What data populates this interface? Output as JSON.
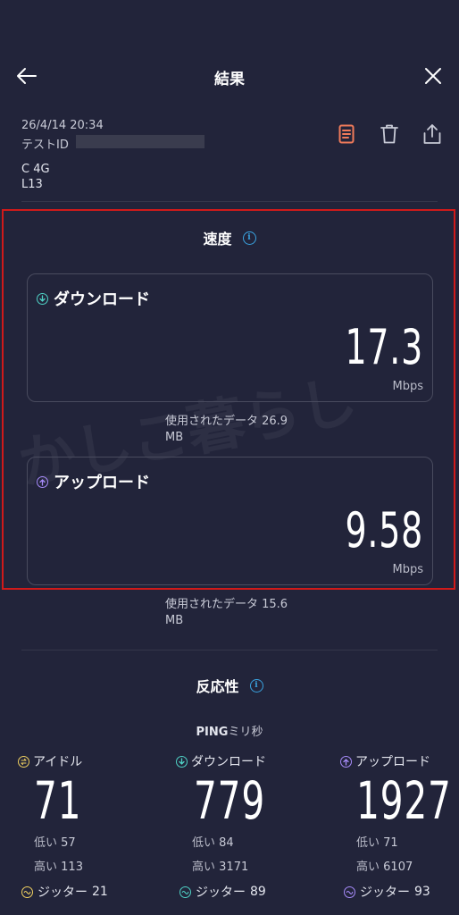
{
  "header": {
    "title": "結果"
  },
  "meta": {
    "date": "26/4/14 20:34",
    "test_id_label": "テストID",
    "operator": "C 4G",
    "device": "L13"
  },
  "speed": {
    "title": "速度",
    "download": {
      "label": "ダウンロード",
      "value": "17.3",
      "unit": "Mbps",
      "used": "使用されたデータ 26.9",
      "used_unit": "MB"
    },
    "upload": {
      "label": "アップロード",
      "value": "9.58",
      "unit": "Mbps",
      "used": "使用されたデータ 15.6",
      "used_unit": "MB"
    }
  },
  "watermark": "かしこ暮らし",
  "responsiveness": {
    "title": "反応性",
    "ping_label": "PING",
    "ping_unit": "ミリ秒",
    "columns": [
      {
        "label": "アイドル",
        "value": "71",
        "low": "低い",
        "low_val": "57",
        "high": "高い",
        "high_val": "113",
        "jitter": "ジッター",
        "jitter_val": "21"
      },
      {
        "label": "ダウンロード",
        "value": "779",
        "low": "低い",
        "low_val": "84",
        "high": "高い",
        "high_val": "3171",
        "jitter": "ジッター",
        "jitter_val": "89"
      },
      {
        "label": "アップロード",
        "value": "1927",
        "low": "低い",
        "low_val": "71",
        "high": "高い",
        "high_val": "6107",
        "jitter": "ジッター",
        "jitter_val": "93"
      }
    ]
  },
  "colors": {
    "background": "#22243a",
    "download_accent": "#4fd1c5",
    "upload_accent": "#a78bfa",
    "idle_accent": "#f0d060",
    "highlight": "#d01a1a",
    "info": "#3aa3e0",
    "doc_icon": "#ef7a5a"
  },
  "icons": {
    "back": "arrow-left-icon",
    "close": "close-icon",
    "document": "document-icon",
    "trash": "trash-icon",
    "share": "share-icon"
  }
}
